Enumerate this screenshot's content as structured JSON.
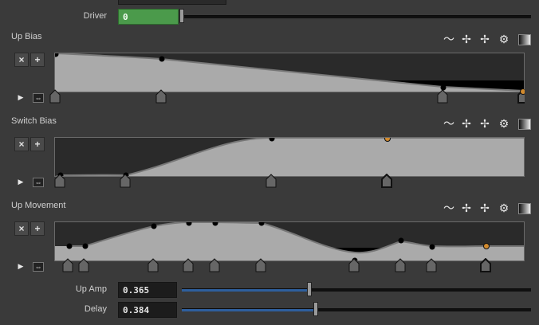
{
  "driver": {
    "label": "Driver",
    "value": "0",
    "slider_fraction": 0.0
  },
  "ramps": [
    {
      "label": "Up Bias"
    },
    {
      "label": "Switch Bias"
    },
    {
      "label": "Up Movement"
    }
  ],
  "controls": {
    "up_amp": {
      "label": "Up Amp",
      "value": "0.365",
      "slider_fraction": 0.365
    },
    "delay": {
      "label": "Delay",
      "value": "0.384",
      "slider_fraction": 0.384
    }
  },
  "buttons": {
    "delete": "×",
    "add": "+",
    "play": "▶",
    "expand": "⇔"
  },
  "icons": [
    "curve-icon",
    "move-horizontal-icon",
    "move-vertical-icon",
    "gear-icon",
    "gradient-icon"
  ],
  "colors": {
    "fill": "#aaaaaa",
    "selected_point": "#d18a2e",
    "driver_field": "#4b9a4b",
    "slider_fill": "#2e5f9e"
  }
}
